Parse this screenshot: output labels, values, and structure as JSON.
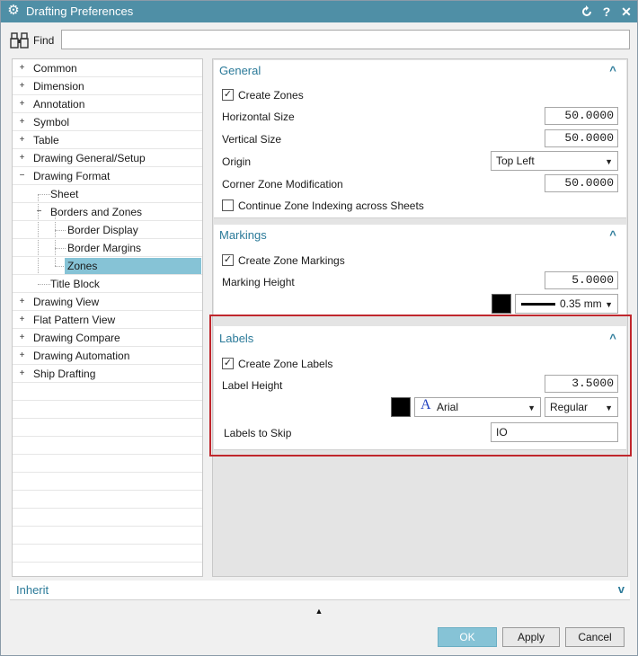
{
  "window": {
    "title": "Drafting Preferences"
  },
  "find": {
    "label": "Find",
    "value": ""
  },
  "tree": {
    "items": [
      {
        "label": "Common"
      },
      {
        "label": "Dimension"
      },
      {
        "label": "Annotation"
      },
      {
        "label": "Symbol"
      },
      {
        "label": "Table"
      },
      {
        "label": "Drawing General/Setup"
      },
      {
        "label": "Drawing Format"
      },
      {
        "label": "Sheet"
      },
      {
        "label": "Borders and Zones"
      },
      {
        "label": "Border Display"
      },
      {
        "label": "Border Margins"
      },
      {
        "label": "Zones"
      },
      {
        "label": "Title Block"
      },
      {
        "label": "Drawing View"
      },
      {
        "label": "Flat Pattern View"
      },
      {
        "label": "Drawing Compare"
      },
      {
        "label": "Drawing Automation"
      },
      {
        "label": "Ship Drafting"
      }
    ]
  },
  "general": {
    "title": "General",
    "create_zones": "Create Zones",
    "horizontal_size_label": "Horizontal Size",
    "horizontal_size": "50.0000",
    "vertical_size_label": "Vertical Size",
    "vertical_size": "50.0000",
    "origin_label": "Origin",
    "origin": "Top Left",
    "corner_label": "Corner Zone Modification",
    "corner": "50.0000",
    "continue_label": "Continue Zone Indexing across Sheets"
  },
  "markings": {
    "title": "Markings",
    "create_markings": "Create Zone Markings",
    "marking_height_label": "Marking Height",
    "marking_height": "5.0000",
    "line_width": "0.35 mm",
    "color": "#000000"
  },
  "labels": {
    "title": "Labels",
    "create_labels": "Create Zone Labels",
    "label_height_label": "Label Height",
    "label_height": "3.5000",
    "font_icon": "A",
    "font": "Arial",
    "style": "Regular",
    "skip_label": "Labels to Skip",
    "skip": "IO",
    "color": "#000000"
  },
  "inherit": {
    "label": "Inherit"
  },
  "buttons": {
    "ok": "OK",
    "apply": "Apply",
    "cancel": "Cancel"
  },
  "colors": {
    "accent": "#4f8fa6",
    "section_title": "#2b7a99",
    "selected": "#86c3d6",
    "highlight": "#c0272d"
  }
}
